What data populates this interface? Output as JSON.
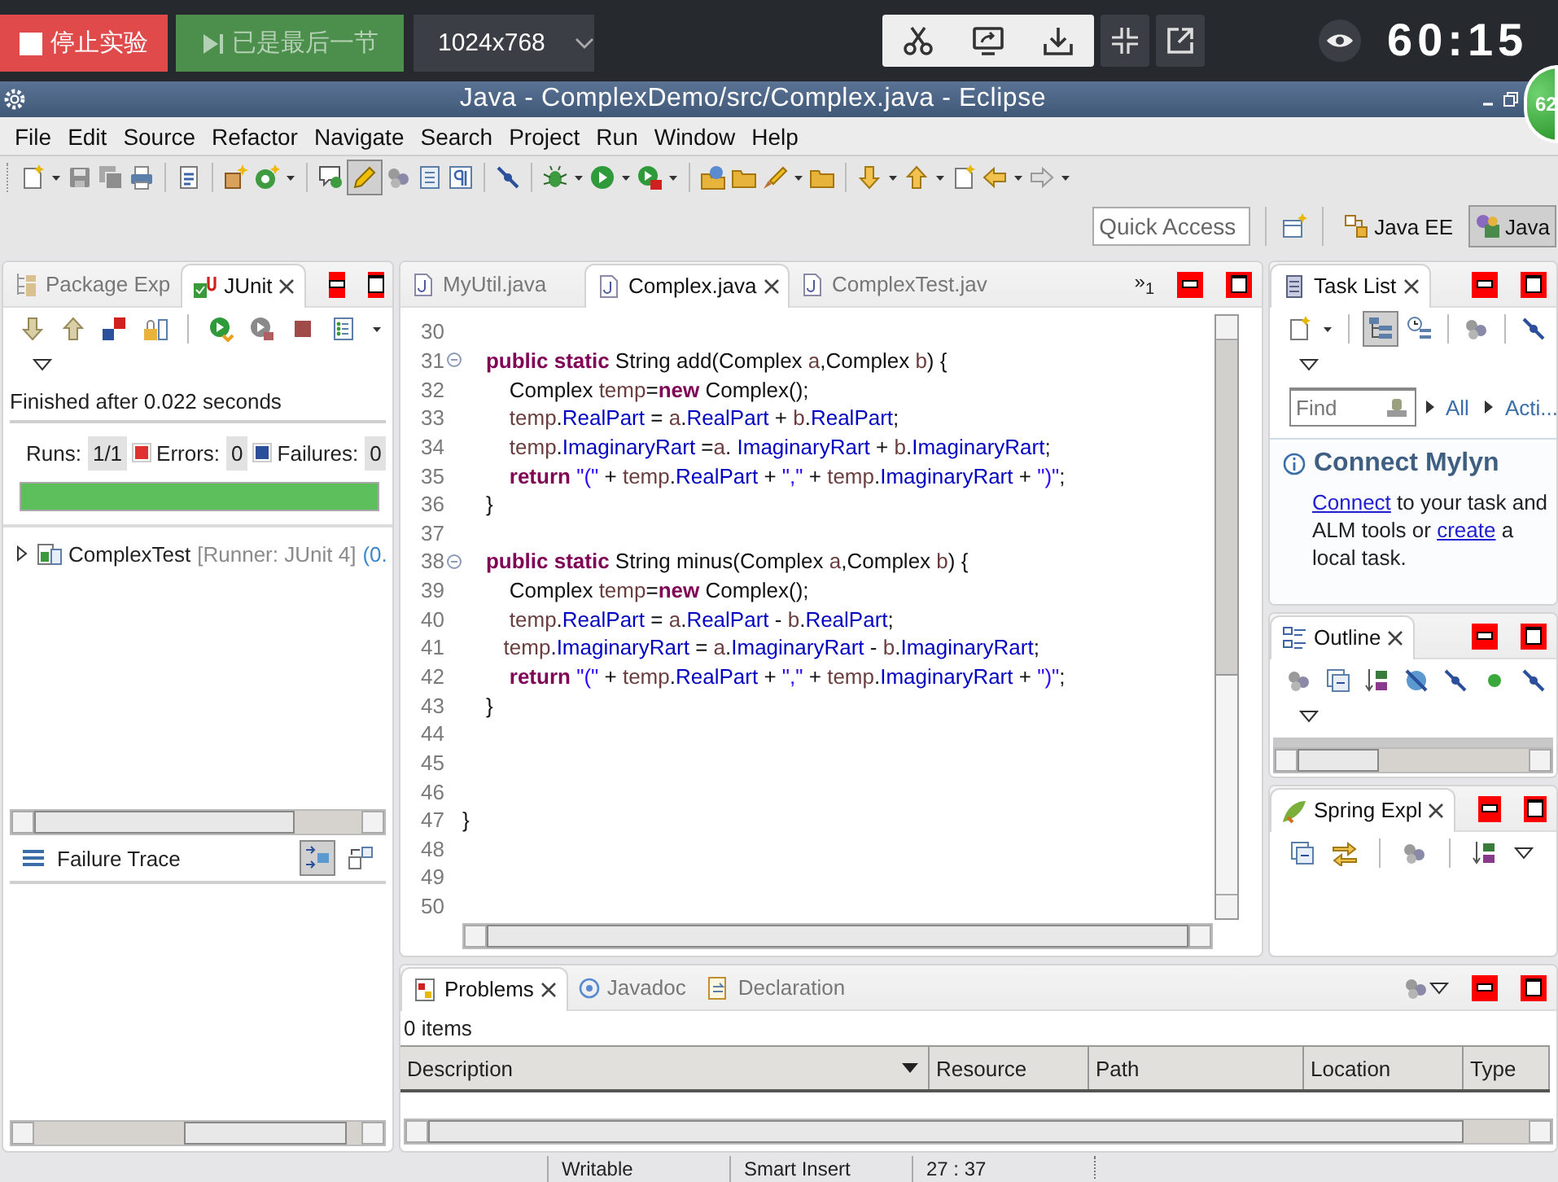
{
  "top_bar": {
    "stop_label": "停止实验",
    "next": {
      "label": "已是最后一节",
      "disabled": true
    },
    "resolution": "1024x768",
    "timer": "60:15"
  },
  "window": {
    "title": "Java - ComplexDemo/src/Complex.java - Eclipse",
    "badge": "62"
  },
  "menu": [
    "File",
    "Edit",
    "Source",
    "Refactor",
    "Navigate",
    "Search",
    "Project",
    "Run",
    "Window",
    "Help"
  ],
  "main_toolbar": {
    "toggle_on": true
  },
  "quick_access": {
    "placeholder": "Quick Access"
  },
  "perspectives": [
    {
      "label": "Java EE",
      "selected": false
    },
    {
      "label": "Java",
      "selected": true
    }
  ],
  "junit_panel": {
    "tabs": [
      {
        "label": "Package Exp",
        "selected": false
      },
      {
        "label": "JUnit",
        "selected": true
      }
    ],
    "status": "Finished after 0.022 seconds",
    "counters": [
      {
        "kind": "runs",
        "label": "Runs:",
        "value": "1/1"
      },
      {
        "kind": "errors",
        "label": "Errors:",
        "value": "0"
      },
      {
        "kind": "failures",
        "label": "Failures:",
        "value": "0"
      }
    ],
    "progress": {
      "level": 1
    },
    "tree": [
      {
        "name": "ComplexTest",
        "runner": "[Runner: JUnit 4]",
        "time": "(0.",
        "expanded": false
      }
    ],
    "failure_trace": "Failure Trace",
    "trace_toggle_on": true
  },
  "editor": {
    "tabs": [
      {
        "label": "MyUtil.java",
        "selected": false
      },
      {
        "label": "Complex.java",
        "selected": true
      },
      {
        "label": "ComplexTest.jav",
        "selected": false
      }
    ],
    "overflow": "»$_{1}$",
    "lines": [
      {
        "num": "30",
        "fold": false
      },
      {
        "num": "31",
        "fold": true,
        "tokens": [
          {
            "kind": "keyword",
            "text": "    public static"
          },
          {
            "kind": "plain",
            "text": " String add(Complex "
          },
          {
            "kind": "local",
            "text": "a"
          },
          {
            "kind": "plain",
            "text": ",Complex "
          },
          {
            "kind": "local",
            "text": "b"
          },
          {
            "kind": "plain",
            "text": ") {"
          }
        ]
      },
      {
        "num": "32",
        "fold": false,
        "tokens": [
          {
            "kind": "plain",
            "text": "        Complex "
          },
          {
            "kind": "local",
            "text": "temp"
          },
          {
            "kind": "plain",
            "text": "="
          },
          {
            "kind": "keyword",
            "text": "new"
          },
          {
            "kind": "plain",
            "text": " Complex();"
          }
        ]
      },
      {
        "num": "33",
        "fold": false,
        "tokens": [
          {
            "kind": "local",
            "text": "        temp"
          },
          {
            "kind": "plain",
            "text": "."
          },
          {
            "kind": "field",
            "text": "RealPart"
          },
          {
            "kind": "plain",
            "text": " = "
          },
          {
            "kind": "local",
            "text": "a"
          },
          {
            "kind": "plain",
            "text": "."
          },
          {
            "kind": "field",
            "text": "RealPart"
          },
          {
            "kind": "plain",
            "text": " + "
          },
          {
            "kind": "local",
            "text": "b"
          },
          {
            "kind": "plain",
            "text": "."
          },
          {
            "kind": "field",
            "text": "RealPart"
          },
          {
            "kind": "plain",
            "text": ";"
          }
        ]
      },
      {
        "num": "34",
        "fold": false,
        "tokens": [
          {
            "kind": "local",
            "text": "        temp"
          },
          {
            "kind": "plain",
            "text": "."
          },
          {
            "kind": "field",
            "text": "ImaginaryRart"
          },
          {
            "kind": "plain",
            "text": " ="
          },
          {
            "kind": "local",
            "text": "a"
          },
          {
            "kind": "plain",
            "text": ". "
          },
          {
            "kind": "field",
            "text": "ImaginaryRart"
          },
          {
            "kind": "plain",
            "text": " + "
          },
          {
            "kind": "local",
            "text": "b"
          },
          {
            "kind": "plain",
            "text": "."
          },
          {
            "kind": "field",
            "text": "ImaginaryRart"
          },
          {
            "kind": "plain",
            "text": ";"
          }
        ]
      },
      {
        "num": "35",
        "fold": false,
        "tokens": [
          {
            "kind": "keyword",
            "text": "        return"
          },
          {
            "kind": "string",
            "text": " \"(\""
          },
          {
            "kind": "plain",
            "text": " + "
          },
          {
            "kind": "local",
            "text": "temp"
          },
          {
            "kind": "plain",
            "text": "."
          },
          {
            "kind": "field",
            "text": "RealPart"
          },
          {
            "kind": "plain",
            "text": " + "
          },
          {
            "kind": "string",
            "text": "\",\""
          },
          {
            "kind": "plain",
            "text": " + "
          },
          {
            "kind": "local",
            "text": "temp"
          },
          {
            "kind": "plain",
            "text": "."
          },
          {
            "kind": "field",
            "text": "ImaginaryRart"
          },
          {
            "kind": "plain",
            "text": " + "
          },
          {
            "kind": "string",
            "text": "\")\""
          },
          {
            "kind": "plain",
            "text": ";"
          }
        ]
      },
      {
        "num": "36",
        "fold": false,
        "tokens": [
          {
            "kind": "plain",
            "text": "    }"
          }
        ]
      },
      {
        "num": "37",
        "fold": false
      },
      {
        "num": "38",
        "fold": true,
        "tokens": [
          {
            "kind": "keyword",
            "text": "    public static"
          },
          {
            "kind": "plain",
            "text": " String minus(Complex "
          },
          {
            "kind": "local",
            "text": "a"
          },
          {
            "kind": "plain",
            "text": ",Complex "
          },
          {
            "kind": "local",
            "text": "b"
          },
          {
            "kind": "plain",
            "text": ") {"
          }
        ]
      },
      {
        "num": "39",
        "fold": false,
        "tokens": [
          {
            "kind": "plain",
            "text": "        Complex "
          },
          {
            "kind": "local",
            "text": "temp"
          },
          {
            "kind": "plain",
            "text": "="
          },
          {
            "kind": "keyword",
            "text": "new"
          },
          {
            "kind": "plain",
            "text": " Complex();"
          }
        ]
      },
      {
        "num": "40",
        "fold": false,
        "tokens": [
          {
            "kind": "local",
            "text": "        temp"
          },
          {
            "kind": "plain",
            "text": "."
          },
          {
            "kind": "field",
            "text": "RealPart"
          },
          {
            "kind": "plain",
            "text": " = "
          },
          {
            "kind": "local",
            "text": "a"
          },
          {
            "kind": "plain",
            "text": "."
          },
          {
            "kind": "field",
            "text": "RealPart"
          },
          {
            "kind": "plain",
            "text": " - "
          },
          {
            "kind": "local",
            "text": "b"
          },
          {
            "kind": "plain",
            "text": "."
          },
          {
            "kind": "field",
            "text": "RealPart"
          },
          {
            "kind": "plain",
            "text": ";"
          }
        ]
      },
      {
        "num": "41",
        "fold": false,
        "tokens": [
          {
            "kind": "local",
            "text": "       temp"
          },
          {
            "kind": "plain",
            "text": "."
          },
          {
            "kind": "field",
            "text": "ImaginaryRart"
          },
          {
            "kind": "plain",
            "text": " = "
          },
          {
            "kind": "local",
            "text": "a"
          },
          {
            "kind": "plain",
            "text": "."
          },
          {
            "kind": "field",
            "text": "ImaginaryRart"
          },
          {
            "kind": "plain",
            "text": " - "
          },
          {
            "kind": "local",
            "text": "b"
          },
          {
            "kind": "plain",
            "text": "."
          },
          {
            "kind": "field",
            "text": "ImaginaryRart"
          },
          {
            "kind": "plain",
            "text": ";"
          }
        ]
      },
      {
        "num": "42",
        "fold": false,
        "tokens": [
          {
            "kind": "keyword",
            "text": "        return"
          },
          {
            "kind": "string",
            "text": " \"(\""
          },
          {
            "kind": "plain",
            "text": " + "
          },
          {
            "kind": "local",
            "text": "temp"
          },
          {
            "kind": "plain",
            "text": "."
          },
          {
            "kind": "field",
            "text": "RealPart"
          },
          {
            "kind": "plain",
            "text": " + "
          },
          {
            "kind": "string",
            "text": "\",\""
          },
          {
            "kind": "plain",
            "text": " + "
          },
          {
            "kind": "local",
            "text": "temp"
          },
          {
            "kind": "plain",
            "text": "."
          },
          {
            "kind": "field",
            "text": "ImaginaryRart"
          },
          {
            "kind": "plain",
            "text": " + "
          },
          {
            "kind": "string",
            "text": "\")\""
          },
          {
            "kind": "plain",
            "text": ";"
          }
        ]
      },
      {
        "num": "43",
        "fold": false,
        "tokens": [
          {
            "kind": "plain",
            "text": "    }"
          }
        ]
      },
      {
        "num": "44",
        "fold": false
      },
      {
        "num": "45",
        "fold": false
      },
      {
        "num": "46",
        "fold": false
      },
      {
        "num": "47",
        "fold": false,
        "tokens": [
          {
            "kind": "plain",
            "text": "}"
          }
        ]
      },
      {
        "num": "48",
        "fold": false
      },
      {
        "num": "49",
        "fold": false
      },
      {
        "num": "50",
        "fold": false
      }
    ]
  },
  "task_list": {
    "tabs": [
      {
        "label": "Task List",
        "selected": true
      }
    ],
    "toggle_on": true,
    "find": {
      "placeholder": "Find"
    },
    "filters": [
      "All",
      "Acti..."
    ],
    "mylyn": {
      "title": "Connect Mylyn",
      "message": [
        {
          "kind": "link",
          "text": "Connect"
        },
        {
          "kind": "text",
          "text": " to your task and ALM tools or "
        },
        {
          "kind": "link",
          "text": "create"
        },
        {
          "kind": "text",
          "text": " a local task."
        }
      ]
    }
  },
  "outline": {
    "tabs": [
      {
        "label": "Outline",
        "selected": true
      }
    ]
  },
  "spring_explorer": {
    "tabs": [
      {
        "label": "Spring Expl",
        "selected": true
      }
    ]
  },
  "problems_panel": {
    "tabs": [
      {
        "label": "Problems",
        "selected": true
      },
      {
        "label": "Javadoc",
        "selected": false
      },
      {
        "label": "Declaration",
        "selected": false
      }
    ],
    "summary": "0 items",
    "columns": [
      {
        "label": "Description",
        "sorted": true
      },
      {
        "label": "Resource",
        "sorted": false
      },
      {
        "label": "Path",
        "sorted": false
      },
      {
        "label": "Location",
        "sorted": false
      },
      {
        "label": "Type",
        "sorted": false
      }
    ]
  },
  "status_bar": [
    "Writable",
    "Smart Insert",
    "27 : 37"
  ]
}
